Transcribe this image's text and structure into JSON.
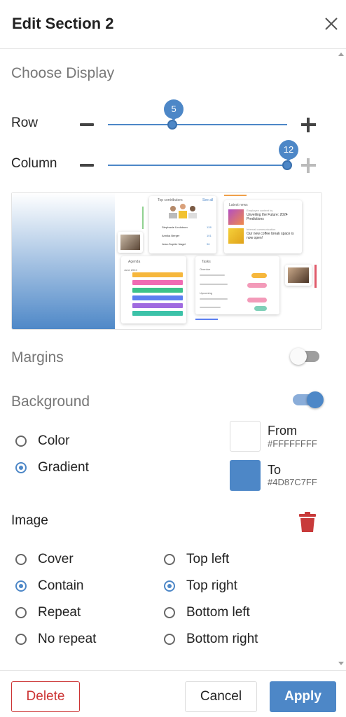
{
  "header": {
    "title": "Edit Section 2"
  },
  "choose_display": {
    "label": "Choose Display",
    "row": {
      "label": "Row",
      "value": "5",
      "fraction": 0.36
    },
    "column": {
      "label": "Column",
      "value": "12",
      "fraction": 1.0
    }
  },
  "preview": {
    "gradient_from": "#FFFFFFFF",
    "gradient_to": "#4D87C7FF",
    "top_contributors": {
      "title": "Top contributors",
      "see_all": "See all",
      "rows": [
        {
          "name": "Stephanie Lindstrom",
          "count": "128"
        },
        {
          "name": "Annika Berger",
          "count": "101"
        },
        {
          "name": "Jean-Sophie Nagel",
          "count": "96"
        }
      ]
    },
    "latest_news": {
      "title": "Latest news",
      "items": [
        {
          "tag": "Employee content by",
          "headline": "Unveiling the Future: 2024 Predictions"
        },
        {
          "tag": "Internal communication",
          "headline": "Our new coffee break space is now open!"
        }
      ]
    },
    "agenda": {
      "title": "Agenda",
      "month": "June 2024"
    },
    "tasks": {
      "title": "Tasks",
      "group1": "Overdue",
      "group2": "Upcoming"
    }
  },
  "margins": {
    "label": "Margins",
    "enabled": false
  },
  "background": {
    "label": "Background",
    "enabled": true,
    "options": [
      {
        "label": "Color",
        "checked": false
      },
      {
        "label": "Gradient",
        "checked": true
      }
    ],
    "from": {
      "label": "From",
      "hex": "#FFFFFFFF",
      "color": "#ffffff"
    },
    "to": {
      "label": "To",
      "hex": "#4D87C7FF",
      "color": "#4d87c7"
    }
  },
  "image": {
    "label": "Image",
    "fit_options": [
      {
        "label": "Cover",
        "checked": false
      },
      {
        "label": "Contain",
        "checked": true
      },
      {
        "label": "Repeat",
        "checked": false
      },
      {
        "label": "No repeat",
        "checked": false
      }
    ],
    "position_options": [
      {
        "label": "Top left",
        "checked": false
      },
      {
        "label": "Top right",
        "checked": true
      },
      {
        "label": "Bottom left",
        "checked": false
      },
      {
        "label": "Bottom right",
        "checked": false
      }
    ]
  },
  "footer": {
    "delete": "Delete",
    "cancel": "Cancel",
    "apply": "Apply"
  },
  "colors": {
    "accent": "#4d87c7",
    "danger": "#cc3333",
    "toggle_off": "#9e9e9e"
  },
  "icons": {
    "close": "close-icon",
    "trash": "trash-icon",
    "minus": "minus-icon",
    "plus": "plus-icon"
  }
}
